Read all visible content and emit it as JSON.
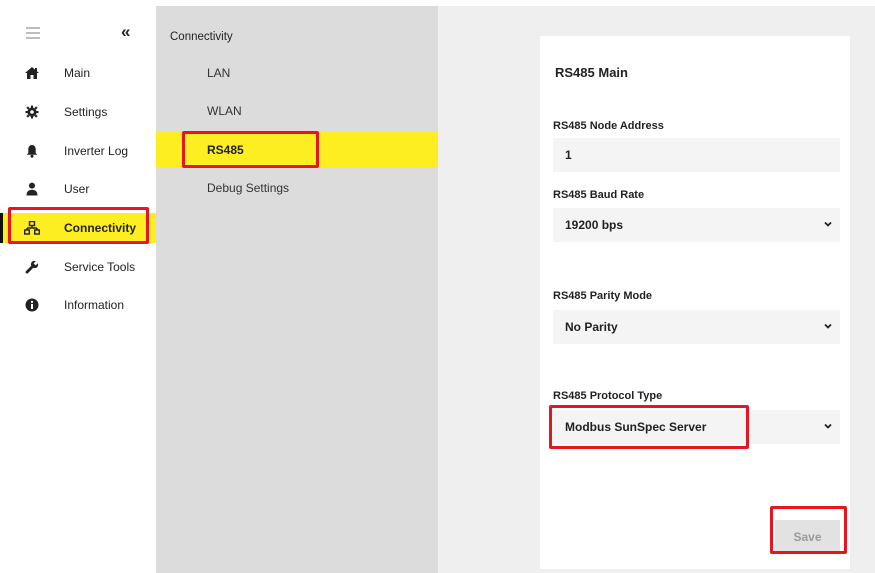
{
  "nav": {
    "collapse_icon": "double-chevron-left-icon",
    "collapse_glyph": "«",
    "items": [
      {
        "label": "Main",
        "icon": "home-icon"
      },
      {
        "label": "Settings",
        "icon": "gear-icon"
      },
      {
        "label": "Inverter Log",
        "icon": "bell-icon"
      },
      {
        "label": "User",
        "icon": "user-icon"
      },
      {
        "label": "Connectivity",
        "icon": "network-icon",
        "active": true
      },
      {
        "label": "Service Tools",
        "icon": "wrench-icon"
      },
      {
        "label": "Information",
        "icon": "info-icon"
      }
    ]
  },
  "subnav": {
    "title": "Connectivity",
    "items": [
      {
        "label": "LAN"
      },
      {
        "label": "WLAN"
      },
      {
        "label": "RS485",
        "active": true
      },
      {
        "label": "Debug Settings"
      }
    ]
  },
  "panel": {
    "title": "RS485 Main",
    "node_address": {
      "label": "RS485 Node Address",
      "value": "1"
    },
    "baud_rate": {
      "label": "RS485 Baud Rate",
      "value": "19200 bps"
    },
    "parity_mode": {
      "label": "RS485 Parity Mode",
      "value": "No Parity"
    },
    "protocol_type": {
      "label": "RS485 Protocol Type",
      "value": "Modbus SunSpec Server"
    },
    "save_label": "Save"
  },
  "colors": {
    "accent": "#fdee21",
    "highlight": "#e8141f",
    "subnav_bg": "#dcdcdc",
    "content_bg": "#efefef"
  }
}
